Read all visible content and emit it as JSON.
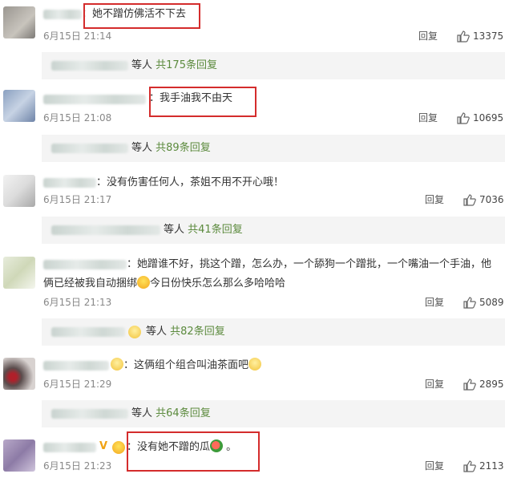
{
  "comments": [
    {
      "text": "：她不蹭仿佛活不下去",
      "date": "6月15日 21:14",
      "reply": "回复",
      "likes": "13375",
      "sub_prefix": "等人",
      "sub_count": "共175条回复"
    },
    {
      "text": "：我手油我不由天",
      "date": "6月15日 21:08",
      "reply": "回复",
      "likes": "10695",
      "sub_prefix": "等人",
      "sub_count": "共89条回复"
    },
    {
      "text": "：没有伤害任何人，茶姐不用不开心哦！",
      "date": "6月15日 21:17",
      "reply": "回复",
      "likes": "7036",
      "sub_prefix": "等人",
      "sub_count": "共41条回复"
    },
    {
      "text1": "：她蹭谁不好，挑这个蹭，怎么办，一个舔狗一个蹭批，一个嘴油一个手油，他",
      "text2a": "俩已经被我自动捆绑",
      "text2b": "今日份快乐怎么那么多哈哈哈",
      "date": "6月15日 21:13",
      "reply": "回复",
      "likes": "5089",
      "sub_prefix": "等人",
      "sub_count": "共82条回复"
    },
    {
      "text": "：这俩组个组合叫油茶面吧",
      "date": "6月15日 21:29",
      "reply": "回复",
      "likes": "2895",
      "sub_prefix": "等人",
      "sub_count": "共64条回复"
    },
    {
      "text": "：没有她不蹭的瓜",
      "tail": "。",
      "badge": "V",
      "date": "6月15日 21:23",
      "reply": "回复",
      "likes": "2113"
    }
  ],
  "colors": {
    "highlight": "#d42c2c",
    "reply_count": "#5b8a3d",
    "meta": "#888888",
    "vip": "#f0a214"
  },
  "icons": {
    "like": "thumbs-up-icon",
    "laugh": "laugh-emoji-icon",
    "melon": "watermelon-emoji-icon",
    "smile": "smile-emoji-icon"
  }
}
